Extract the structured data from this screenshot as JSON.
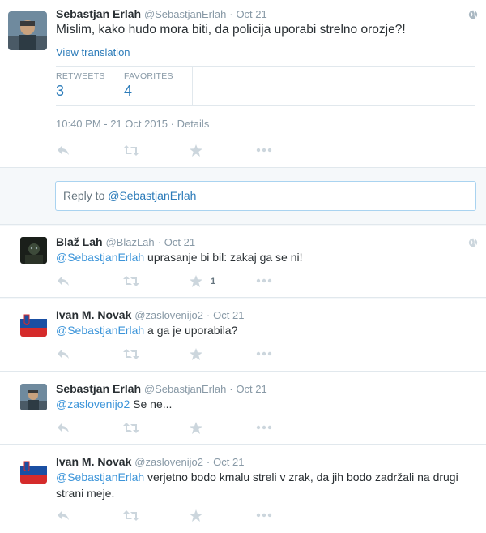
{
  "main_tweet": {
    "fullname": "Sebastjan Erlah",
    "screenname": "@SebastjanErlah",
    "dot": "·",
    "time": "Oct 21",
    "text": "Mislim, kako hudo mora biti, da policija uporabi strelno orozje?!",
    "translation_link": "View translation",
    "retweets_label": "RETWEETS",
    "retweets_count": "3",
    "favorites_label": "FAVORITES",
    "favorites_count": "4",
    "datetime": "10:40 PM - 21 Oct 2015 · Details"
  },
  "reply_box": {
    "placeholder": "Reply to ",
    "mention": "@SebastjanErlah"
  },
  "replies": [
    {
      "fullname": "Blaž Lah",
      "screenname": "@BlazLah",
      "dot": "·",
      "time": "Oct 21",
      "mention": "@SebastjanErlah",
      "text": " uprasanje bi bil: zakaj ga se ni!",
      "fav_count": "1"
    },
    {
      "fullname": "Ivan M. Novak",
      "screenname": "@zaslovenijo2",
      "dot": "·",
      "time": "Oct 21",
      "mention": "@SebastjanErlah",
      "text": " a ga je uporabila?",
      "fav_count": ""
    },
    {
      "fullname": "Sebastjan Erlah",
      "screenname": "@SebastjanErlah",
      "dot": "·",
      "time": "Oct 21",
      "mention": "@zaslovenijo2",
      "text": " Se ne...",
      "fav_count": ""
    },
    {
      "fullname": "Ivan M. Novak",
      "screenname": "@zaslovenijo2",
      "dot": "·",
      "time": "Oct 21",
      "mention": "@SebastjanErlah",
      "text": " verjetno bodo kmalu streli v zrak, da jih bodo zadržali na drugi strani meje.",
      "fav_count": ""
    }
  ],
  "icons": [
    "reply-icon",
    "retweet-icon",
    "favorite-icon",
    "more-icon",
    "globe-icon"
  ],
  "colors": {
    "link": "#2b7bb9",
    "mention": "#3b94d9",
    "muted": "#8899a6",
    "icon": "#ccd6dd"
  }
}
